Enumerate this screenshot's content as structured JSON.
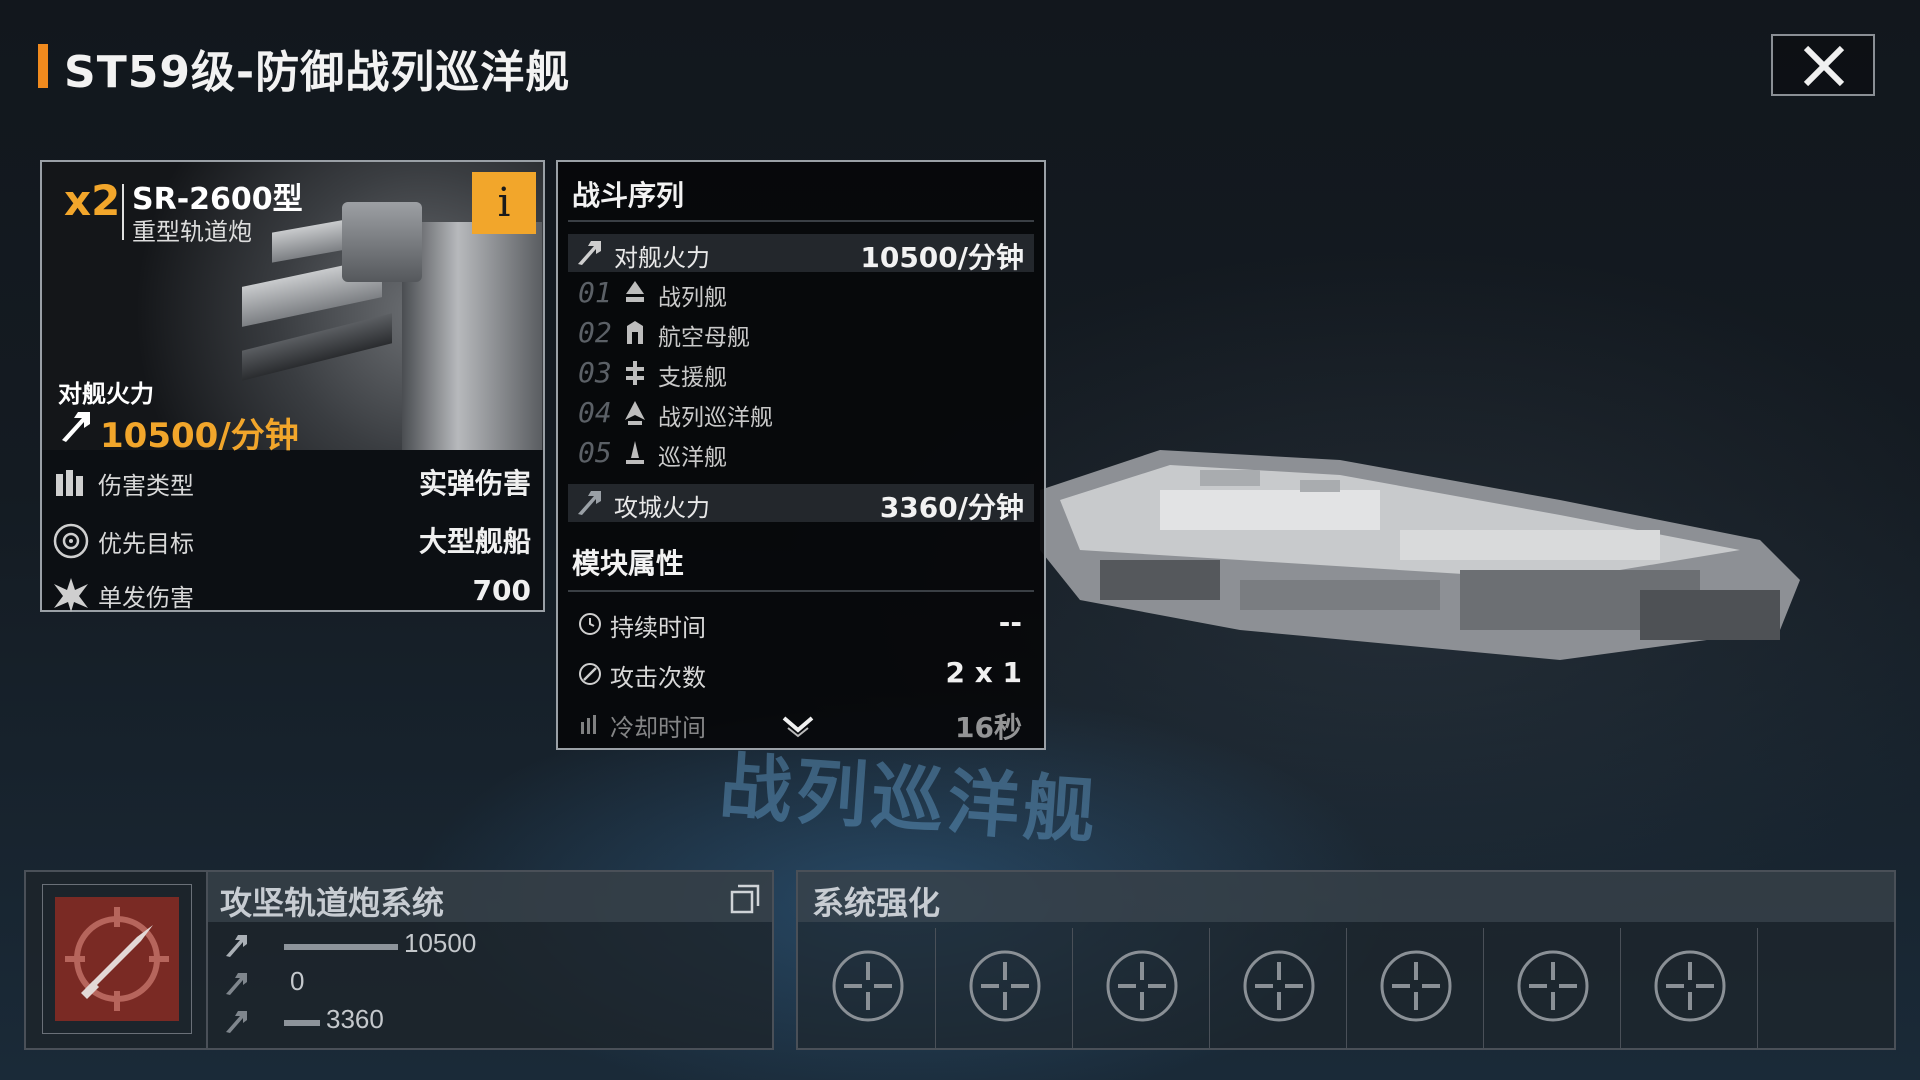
{
  "header": {
    "title": "ST59级-防御战列巡洋舰"
  },
  "weapon": {
    "count": "x2",
    "name": "SR-2600型",
    "type": "重型轨道炮",
    "info_label": "i",
    "firepower_label": "对舰火力",
    "firepower_value": "10500/分钟",
    "rows": [
      {
        "label": "伤害类型",
        "value": "实弹伤害",
        "icon": "ammo-icon"
      },
      {
        "label": "优先目标",
        "value": "大型舰船",
        "icon": "target-icon"
      },
      {
        "label": "单发伤害",
        "value": "700",
        "icon": "burst-icon"
      }
    ]
  },
  "stats": {
    "battle_title": "战斗序列",
    "anti_ship_label": "对舰火力",
    "anti_ship_value": "10500/分钟",
    "priorities": [
      {
        "num": "01",
        "label": "战列舰"
      },
      {
        "num": "02",
        "label": "航空母舰"
      },
      {
        "num": "03",
        "label": "支援舰"
      },
      {
        "num": "04",
        "label": "战列巡洋舰"
      },
      {
        "num": "05",
        "label": "巡洋舰"
      }
    ],
    "siege_label": "攻城火力",
    "siege_value": "3360/分钟",
    "module_title": "模块属性",
    "module_rows": [
      {
        "label": "持续时间",
        "value": "--"
      },
      {
        "label": "攻击次数",
        "value": "2 x 1"
      },
      {
        "label": "冷却时间",
        "value": "16秒"
      }
    ]
  },
  "background": {
    "deco_text": "战列巡洋舰"
  },
  "module_system": {
    "title": "攻坚轨道炮系统",
    "bars": [
      {
        "value": "10500",
        "fraction": 0.38
      },
      {
        "value": "0",
        "fraction": 0
      },
      {
        "value": "3360",
        "fraction": 0.12
      }
    ]
  },
  "enhancement": {
    "title": "系统强化",
    "slot_count": 7
  },
  "colors": {
    "accent": "#f2a62b",
    "title_accent": "#f08a1e",
    "module_icon_bg": "#7a2a24"
  }
}
